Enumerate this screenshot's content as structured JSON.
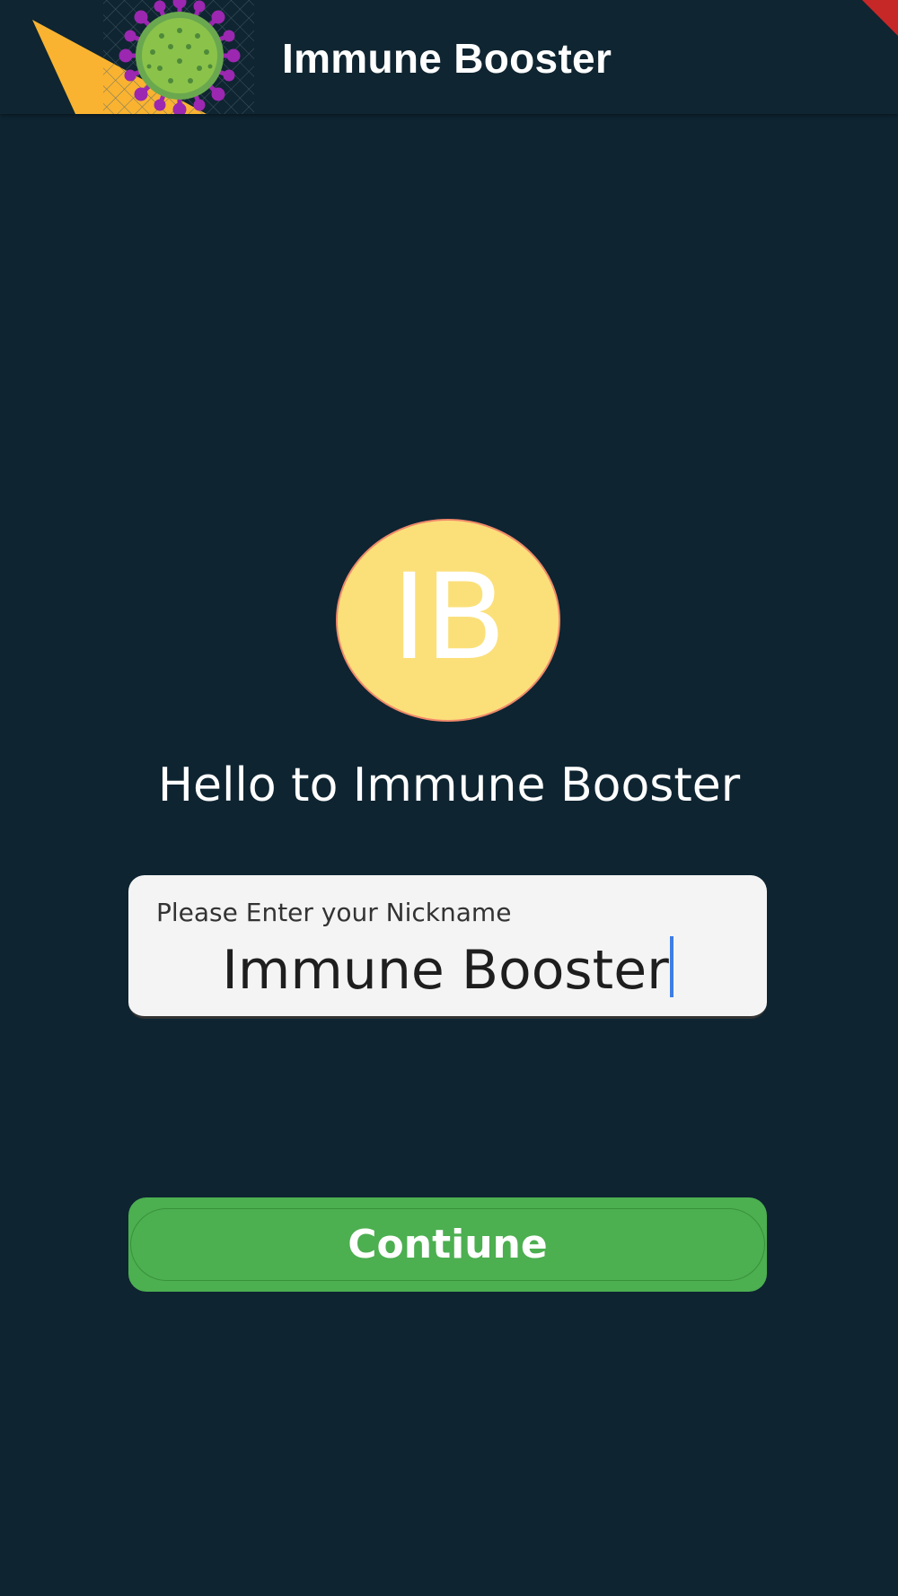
{
  "app_bar": {
    "logo_icon": "virus-logo-icon",
    "title": "Immune Booster"
  },
  "avatar": {
    "initials": "IB"
  },
  "welcome_text": "Hello to Immune Booster",
  "nickname_field": {
    "label": "Please Enter your Nickname",
    "value": "Immune Booster"
  },
  "continue_button": {
    "label": "Contiune"
  },
  "colors": {
    "background": "#0e2431",
    "app_bar": "#0f2531",
    "avatar_fill": "#fbe07a",
    "avatar_border": "#f08a6a",
    "button": "#4caf50",
    "field_background": "#f4f4f4",
    "caret": "#3d7de5",
    "logo_triangle": "#f9b331",
    "virus_body": "#8bc34a",
    "virus_spikes": "#9c27b0"
  }
}
